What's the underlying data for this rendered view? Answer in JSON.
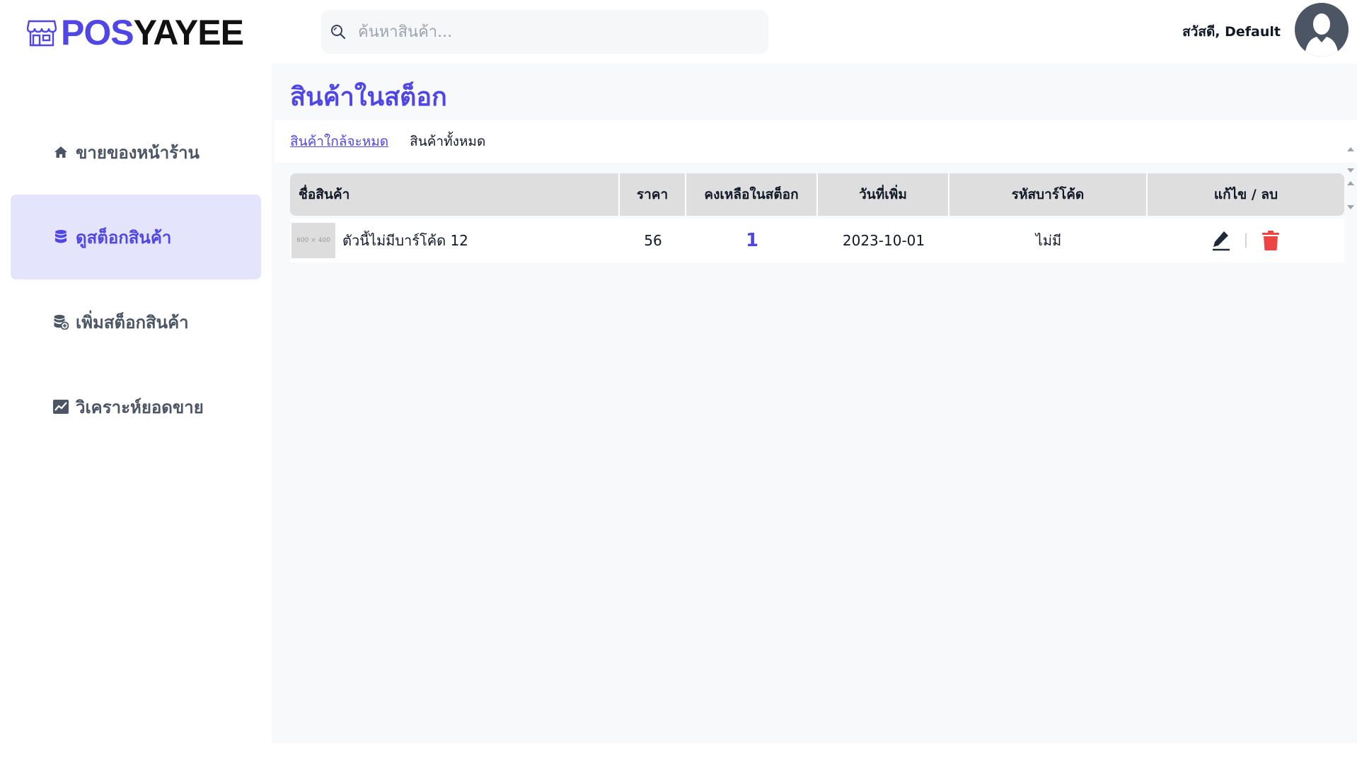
{
  "brand": {
    "pos": "POS",
    "rest": "YAYEE",
    "accent": "#4f46e5"
  },
  "search": {
    "placeholder": "ค้นหาสินค้า..."
  },
  "user": {
    "greeting": "สวัสดี, Default"
  },
  "sidebar": {
    "items": [
      {
        "label": "ขายของหน้าร้าน",
        "icon": "home-icon",
        "active": false
      },
      {
        "label": "ดูสต็อกสินค้า",
        "icon": "database-icon",
        "active": true
      },
      {
        "label": "เพิ่มสต็อกสินค้า",
        "icon": "database-add-icon",
        "active": false
      },
      {
        "label": "วิเคราะห์ยอดขาย",
        "icon": "chart-icon",
        "active": false
      }
    ]
  },
  "page": {
    "title": "สินค้าในสต็อก",
    "tabs": [
      {
        "label": "สินค้าใกล้จะหมด",
        "active": true
      },
      {
        "label": "สินค้าทั้งหมด",
        "active": false
      }
    ]
  },
  "table": {
    "headers": {
      "name": "ชื่อสินค้า",
      "price": "ราคา",
      "stock": "คงเหลือในสต็อก",
      "date": "วันที่เพิ่ม",
      "barcode": "รหัสบาร์โค้ด",
      "actions": "แก้ไข / ลบ"
    },
    "rows": [
      {
        "thumb": "600 × 400",
        "name": "ตัวนี้ไม่มีบาร์โค้ด 12",
        "price": "56",
        "stock": "1",
        "date": "2023-10-01",
        "barcode": "ไม่มี"
      }
    ]
  },
  "colors": {
    "delete": "#ef4444",
    "edit": "#1f2937",
    "active_bg": "#e5e4fd"
  }
}
